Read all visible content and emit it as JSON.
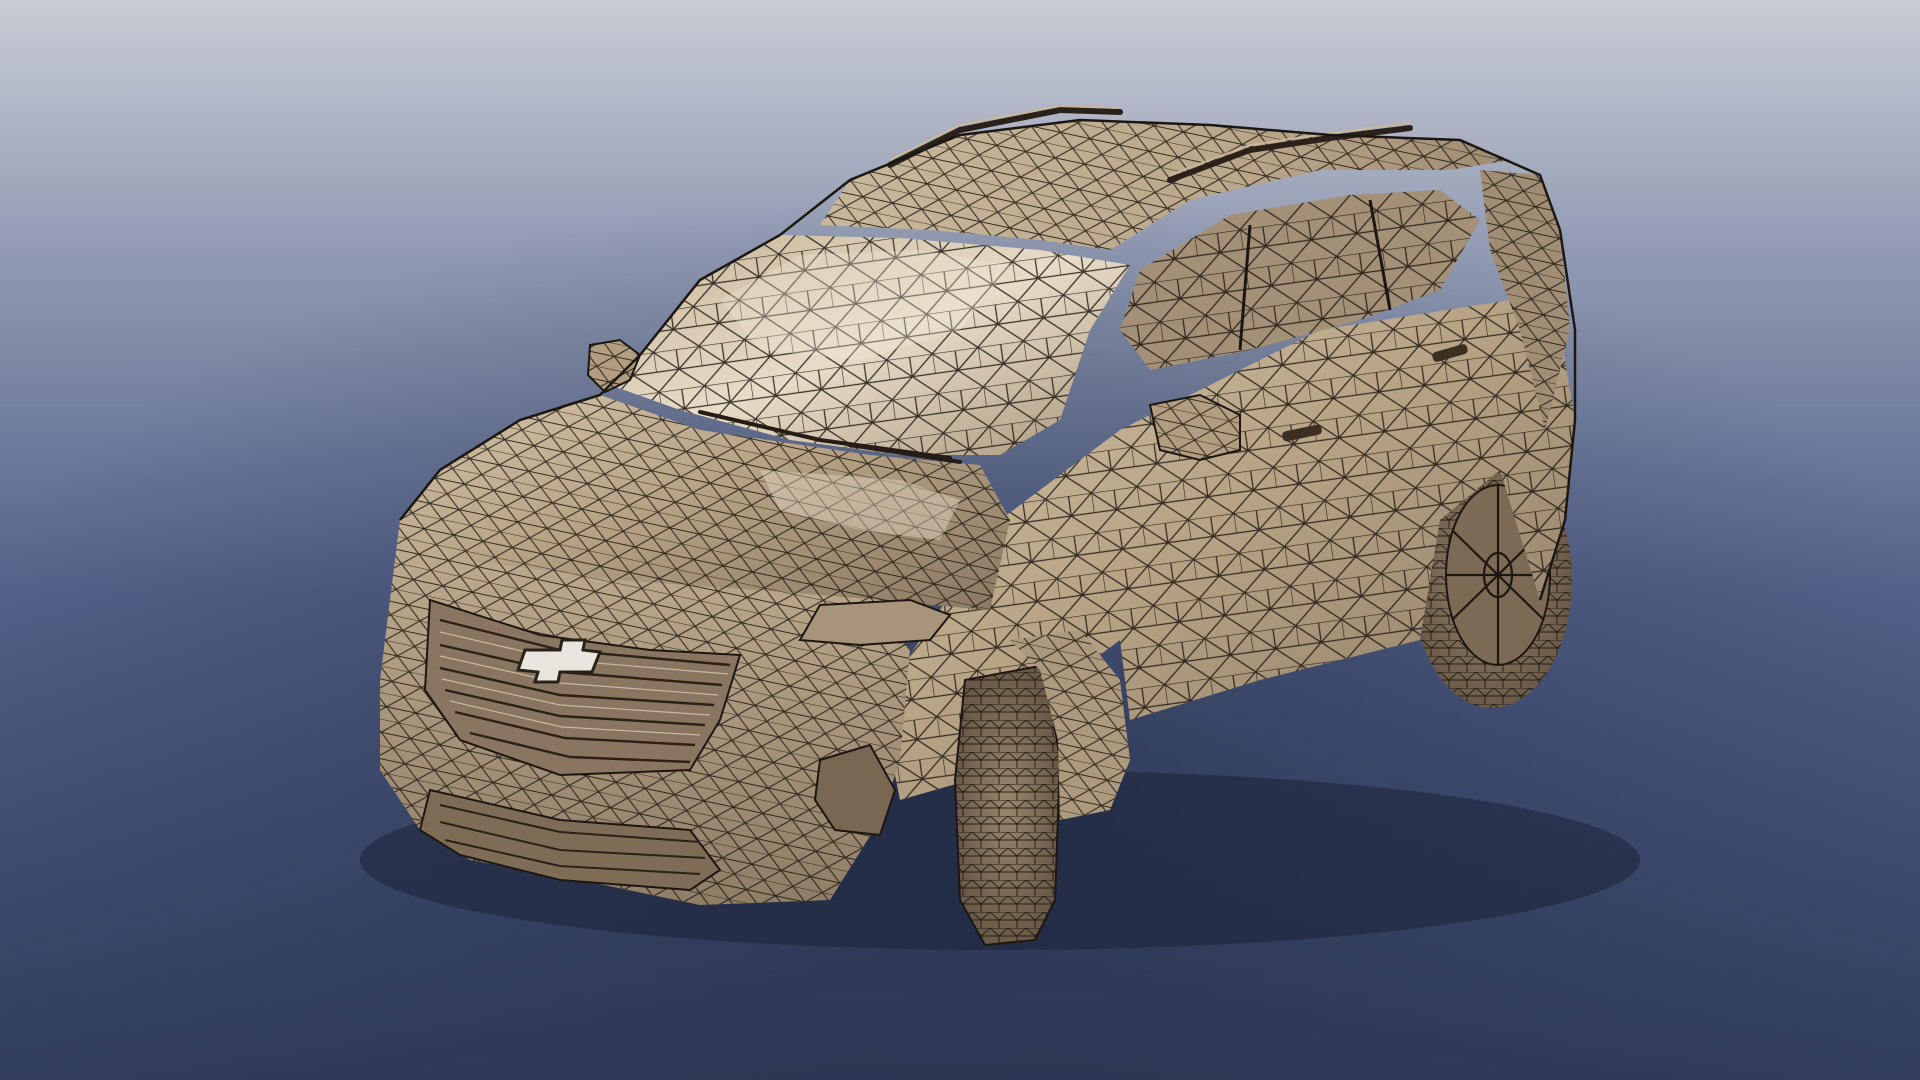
{
  "scene": {
    "subject": "car-wireframe-render",
    "background_top": "#c8ccd6",
    "background_mid": "#5d6a8e",
    "background_bottom": "#33405f",
    "body_color": "#b9a486",
    "body_highlight": "#e2d6c2",
    "body_shadow": "#6c5c48",
    "wire_color": "#1c1712",
    "tire_color": "#7e6c58",
    "logo_color": "#e9e6df"
  }
}
